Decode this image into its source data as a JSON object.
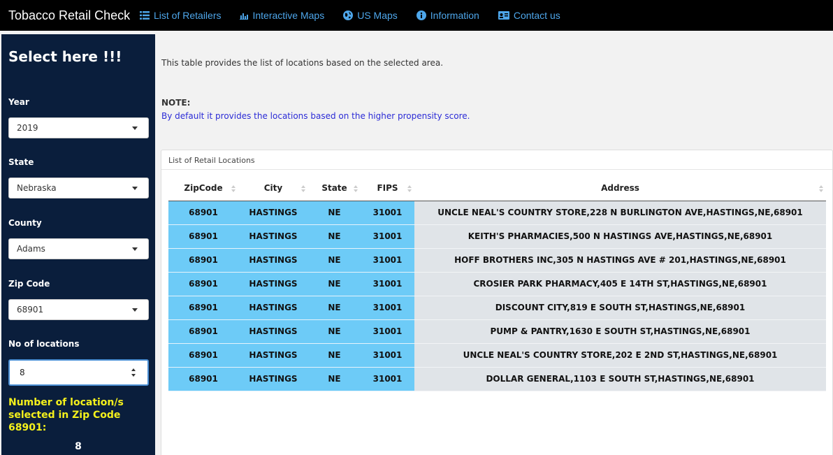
{
  "navbar": {
    "brand": "Tobacco Retail Check",
    "items": [
      {
        "label": "List of Retailers",
        "icon": "list-icon"
      },
      {
        "label": "Interactive Maps",
        "icon": "bar-chart-icon"
      },
      {
        "label": "US Maps",
        "icon": "globe-icon"
      },
      {
        "label": "Information",
        "icon": "info-circle-icon"
      },
      {
        "label": "Contact us",
        "icon": "id-card-icon"
      }
    ]
  },
  "sidebar": {
    "title": "Select here !!!",
    "year_label": "Year",
    "year_value": "2019",
    "state_label": "State",
    "state_value": "Nebraska",
    "county_label": "County",
    "county_value": "Adams",
    "zip_label": "Zip Code",
    "zip_value": "68901",
    "locations_label": "No of locations",
    "locations_value": "8",
    "summary_text": "Number of location/s selected in Zip Code 68901:",
    "summary_count": "8"
  },
  "main": {
    "description": "This table provides the list of locations based on the selected area.",
    "note_heading": "NOTE:",
    "note_text": "By default it provides the locations based on the higher propensity score.",
    "panel_title": "List of Retail Locations"
  },
  "table": {
    "columns": [
      "ZipCode",
      "City",
      "State",
      "FIPS",
      "Address"
    ],
    "rows": [
      [
        "68901",
        "HASTINGS",
        "NE",
        "31001",
        "UNCLE NEAL'S COUNTRY STORE,228 N BURLINGTON AVE,HASTINGS,NE,68901"
      ],
      [
        "68901",
        "HASTINGS",
        "NE",
        "31001",
        "KEITH'S PHARMACIES,500 N HASTINGS AVE,HASTINGS,NE,68901"
      ],
      [
        "68901",
        "HASTINGS",
        "NE",
        "31001",
        "HOFF BROTHERS INC,305 N HASTINGS AVE # 201,HASTINGS,NE,68901"
      ],
      [
        "68901",
        "HASTINGS",
        "NE",
        "31001",
        "CROSIER PARK PHARMACY,405 E 14TH ST,HASTINGS,NE,68901"
      ],
      [
        "68901",
        "HASTINGS",
        "NE",
        "31001",
        "DISCOUNT CITY,819 E SOUTH ST,HASTINGS,NE,68901"
      ],
      [
        "68901",
        "HASTINGS",
        "NE",
        "31001",
        "PUMP & PANTRY,1630 E SOUTH ST,HASTINGS,NE,68901"
      ],
      [
        "68901",
        "HASTINGS",
        "NE",
        "31001",
        "UNCLE NEAL'S COUNTRY STORE,202 E 2ND ST,HASTINGS,NE,68901"
      ],
      [
        "68901",
        "HASTINGS",
        "NE",
        "31001",
        "DOLLAR GENERAL,1103 E SOUTH ST,HASTINGS,NE,68901"
      ]
    ]
  },
  "colors": {
    "navbar_bg": "#000000",
    "nav_link": "#4ea6ea",
    "sidebar_bg": "#0a1e3c",
    "highlight_text": "#f4f01c",
    "cell_blue": "#6dcbf7",
    "cell_grey": "#e0e4e8",
    "note_text": "#2b2bd6"
  }
}
